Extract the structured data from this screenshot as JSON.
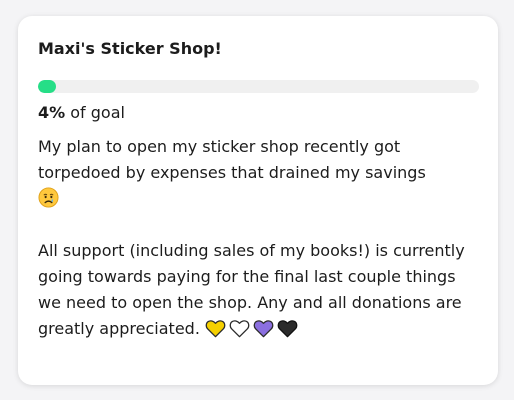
{
  "card": {
    "title": "Maxi's Sticker Shop!",
    "progress": {
      "percent_value": 0.04,
      "percent_label": "4%",
      "suffix": " of goal",
      "fill_color": "#26de87"
    },
    "description": {
      "paragraph1": "My plan to open my sticker shop recently got torpedoed by expenses that drained my savings",
      "paragraph1_emoji": "sad-tear-face-icon",
      "paragraph2": "All support (including sales of my books!) is currently going towards paying for the final last couple things we need to open the shop. Any and all donations are greatly appreciated.",
      "paragraph2_emojis": [
        "yellow-heart-icon",
        "white-heart-icon",
        "purple-heart-icon",
        "black-heart-icon"
      ]
    }
  },
  "colors": {
    "background": "#f4f4f6",
    "card": "#ffffff",
    "track": "#f0f0f0",
    "heart_yellow": "#f5d000",
    "heart_white": "#ffffff",
    "heart_purple": "#8b6fe0",
    "heart_black": "#2b2b2b"
  }
}
